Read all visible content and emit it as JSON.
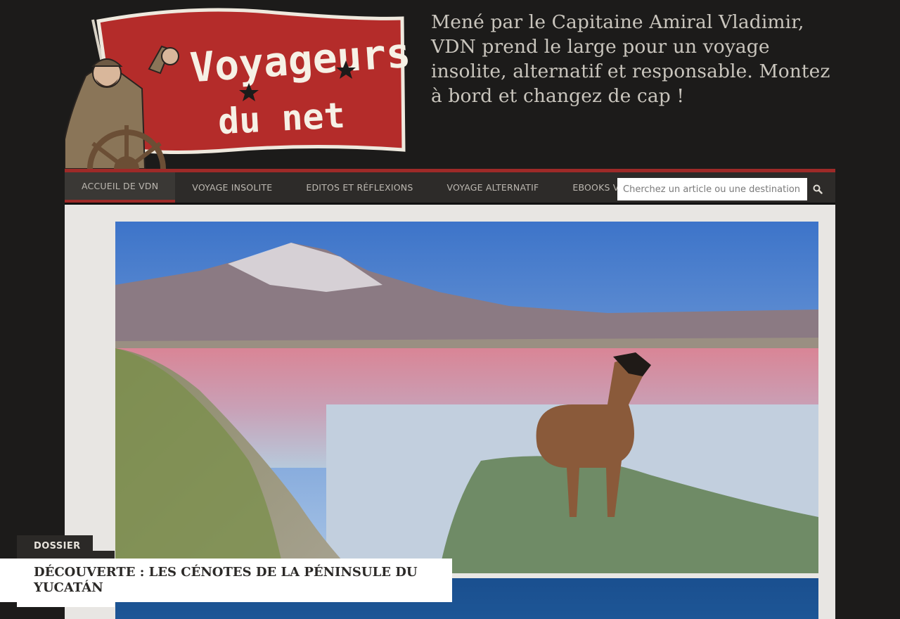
{
  "header": {
    "logo_line1": "Voyageurs",
    "logo_line2": "du net",
    "tagline": "Mené par le Capitaine Amiral Vladimir, VDN prend le large pour un voyage insolite, alternatif et responsable. Montez à bord et changez de cap !"
  },
  "nav": {
    "items": [
      {
        "label": "ACCUEIL DE VDN",
        "active": true
      },
      {
        "label": "VOYAGE INSOLITE",
        "active": false
      },
      {
        "label": "EDITOS ET RÉFLEXIONS",
        "active": false
      },
      {
        "label": "VOYAGE ALTERNATIF",
        "active": false
      },
      {
        "label": "EBOOKS VOYAGE",
        "active": false
      }
    ],
    "search_placeholder": "Cherchez un article ou une destination",
    "search_icon": "search-icon"
  },
  "featured": {
    "category": "DOSSIER",
    "title": "DÉCOUVERTE : LES CÉNOTES DE LA PÉNINSULE DU YUCATÁN"
  },
  "colors": {
    "accent": "#9e2a28",
    "background": "#1c1b1a",
    "nav_bg": "#2d2b29",
    "content_bg": "#e8e6e3"
  }
}
